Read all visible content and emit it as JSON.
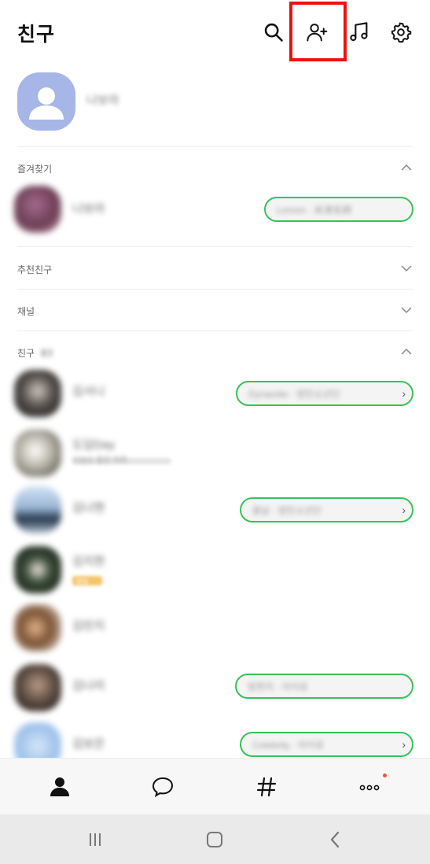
{
  "header": {
    "title": "친구",
    "icons": [
      "search-icon",
      "add-friend-icon",
      "music-icon",
      "settings-icon"
    ]
  },
  "profile": {
    "name": "나보라"
  },
  "sections": {
    "favorites": "즐겨찾기",
    "recommended": "추천친구",
    "channels": "채널",
    "friends": "친구",
    "friends_count": "83"
  },
  "favorites": [
    {
      "name": "나보라",
      "music": "Lemon · 米津玄師"
    }
  ],
  "friends": [
    {
      "name": "김서니",
      "music": "Dynamite · 방탄소년단"
    },
    {
      "name": "도담Day",
      "status": "오늘도 좋은 하루"
    },
    {
      "name": "김나현",
      "music": "봄날 · 방탄소년단"
    },
    {
      "name": "김지현",
      "badge": "생일"
    },
    {
      "name": "김민지"
    },
    {
      "name": "김나리",
      "music": "밤편지 · 아이유"
    },
    {
      "name": "김보은",
      "music": "Celebrity · 아이유"
    }
  ],
  "colors": {
    "accent_green": "#37c25a",
    "highlight_red": "#ee1111",
    "notification_red": "#ff4b3a",
    "avatar_default": "#a6b6e6"
  },
  "tabs": [
    "friends-tab",
    "chats-tab",
    "openchat-tab",
    "more-tab"
  ]
}
